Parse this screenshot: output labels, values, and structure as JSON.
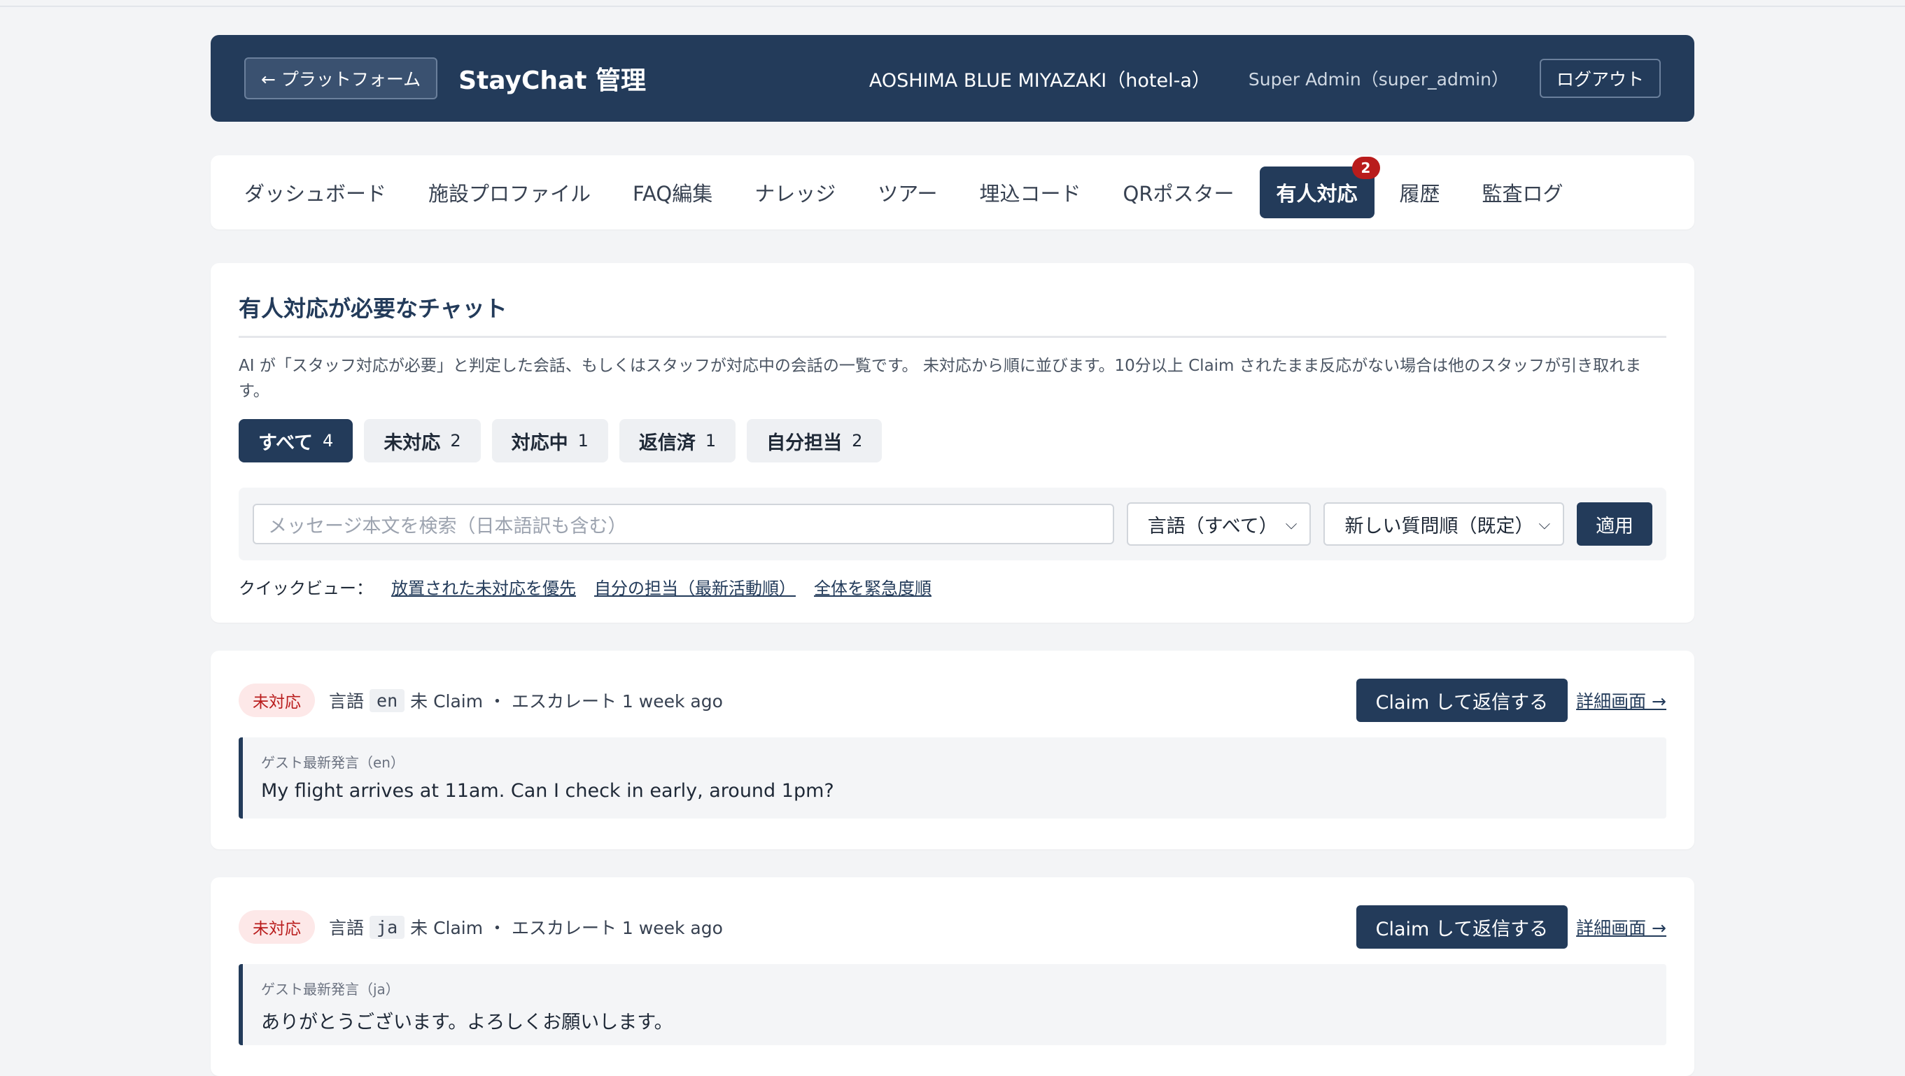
{
  "header": {
    "back_label": "← プラットフォーム",
    "title": "StayChat 管理",
    "hotel": "AOSHIMA BLUE MIYAZAKI（hotel-a）",
    "user": "Super Admin（super_admin）",
    "logout_label": "ログアウト"
  },
  "tabs": [
    {
      "label": "ダッシュボード"
    },
    {
      "label": "施設プロファイル"
    },
    {
      "label": "FAQ編集"
    },
    {
      "label": "ナレッジ"
    },
    {
      "label": "ツアー"
    },
    {
      "label": "埋込コード"
    },
    {
      "label": "QRポスター"
    },
    {
      "label": "有人対応",
      "badge": "2",
      "active": true
    },
    {
      "label": "履歴"
    },
    {
      "label": "監査ログ"
    }
  ],
  "main": {
    "title": "有人対応が必要なチャット",
    "description": "AI が「スタッフ対応が必要」と判定した会話、もしくはスタッフが対応中の会話の一覧です。 未対応から順に並びます。10分以上 Claim されたまま反応がない場合は他のスタッフが引き取れます。",
    "filters": [
      {
        "label": "すべて",
        "count": "4",
        "active": true
      },
      {
        "label": "未対応",
        "count": "2"
      },
      {
        "label": "対応中",
        "count": "1"
      },
      {
        "label": "返信済",
        "count": "1"
      },
      {
        "label": "自分担当",
        "count": "2"
      }
    ],
    "search_placeholder": "メッセージ本文を検索（日本語訳も含む）",
    "language_select": "言語（すべて）",
    "sort_select": "新しい質問順（既定）",
    "apply_label": "適用",
    "quick_view_label": "クイックビュー：",
    "quick_links": [
      "放置された未対応を優先",
      "自分の担当（最新活動順）",
      "全体を緊急度順"
    ]
  },
  "conversations": [
    {
      "status": "未対応",
      "lang_label": "言語",
      "lang": "en",
      "meta": "未 Claim ・ エスカレート 1 week ago",
      "claim_label": "Claim して返信する",
      "detail_label": "詳細画面 →",
      "message_label": "ゲスト最新発言（en）",
      "message": "My flight arrives at 11am. Can I check in early, around 1pm?"
    },
    {
      "status": "未対応",
      "lang_label": "言語",
      "lang": "ja",
      "meta": "未 Claim ・ エスカレート 1 week ago",
      "claim_label": "Claim して返信する",
      "detail_label": "詳細画面 →",
      "message_label": "ゲスト最新発言（ja）",
      "message": "ありがとうございます。よろしくお願いします。"
    }
  ],
  "colors": {
    "brand": "#233b5a",
    "danger": "#b91c1c",
    "danger_bg": "#fde8e8"
  }
}
